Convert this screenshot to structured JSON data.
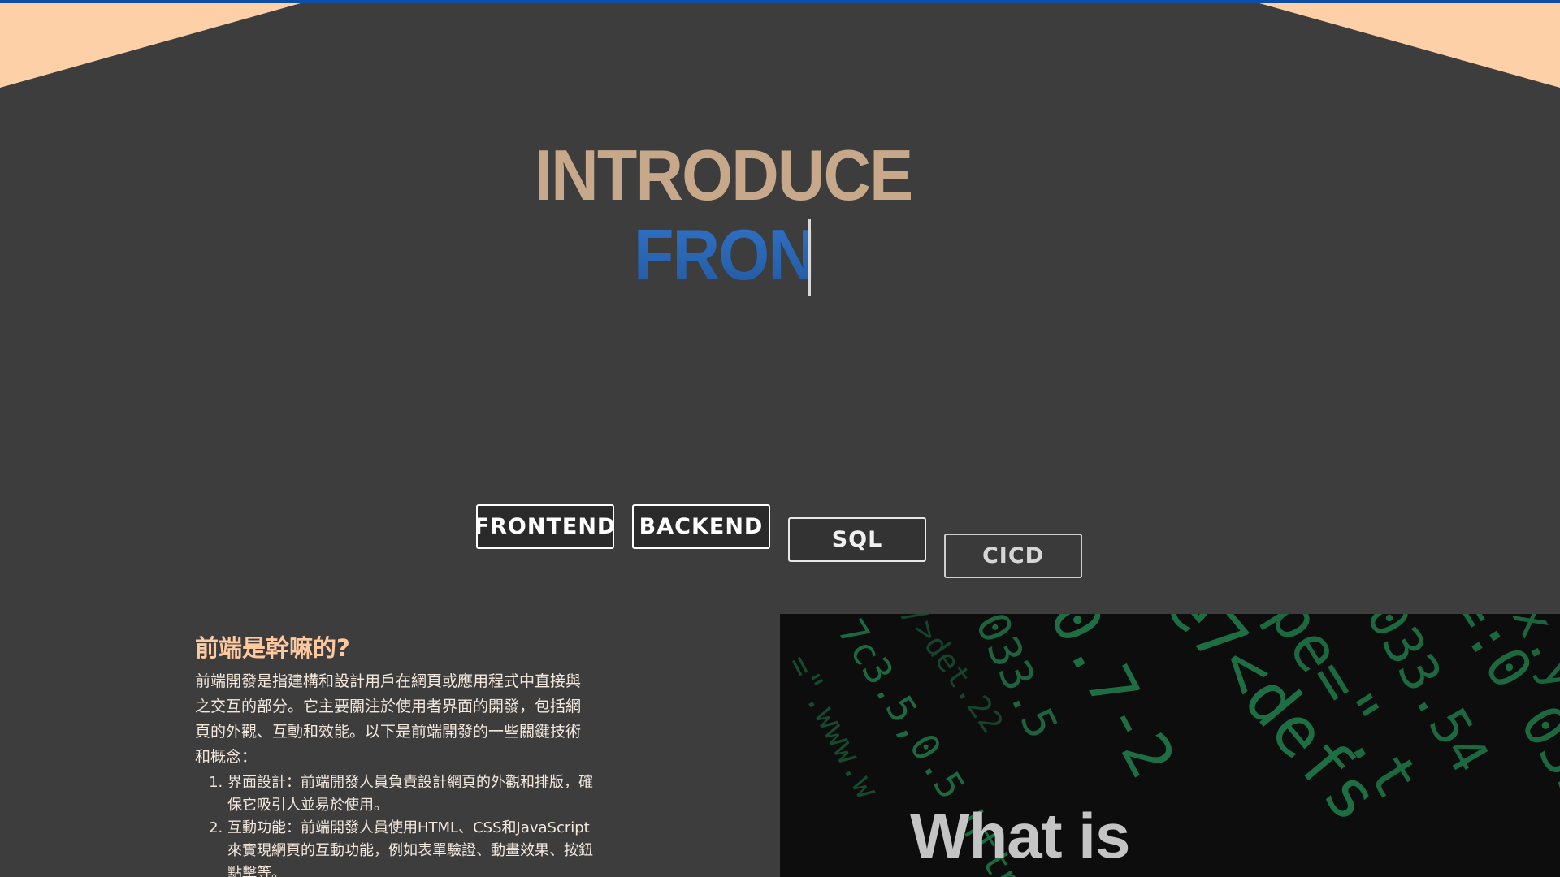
{
  "hero": {
    "title": "INTRODUCE",
    "typed_text": "FRON"
  },
  "tabs": [
    {
      "label": "FRONTEND"
    },
    {
      "label": "BACKEND"
    },
    {
      "label": "SQL"
    },
    {
      "label": "CICD"
    }
  ],
  "article": {
    "heading": "前端是幹嘛的?",
    "intro": "前端開發是指建構和設計用戶在網頁或應用程式中直接與之交互的部分。它主要關注於使用者界面的開發，包括網頁的外觀、互動和效能。以下是前端開發的一些關鍵技術和概念：",
    "items": [
      "界面設計：前端開發人員負責設計網頁的外觀和排版，確保它吸引人並易於使用。",
      "互動功能：前端開發人員使用HTML、CSS和JavaScript來實現網頁的互動功能，例如表單驗證、動畫效果、按鈕點擊等。"
    ]
  },
  "media": {
    "caption": "What is"
  },
  "colors": {
    "background": "#3d3d3d",
    "accent_top_bar": "#0d4fa8",
    "corner_peach": "#fdd0a8",
    "title_tan": "#c8a88a",
    "typed_blue": "#2a66b8",
    "heading_peach": "#ffc9a0",
    "code_green": "#1f7a4a"
  }
}
